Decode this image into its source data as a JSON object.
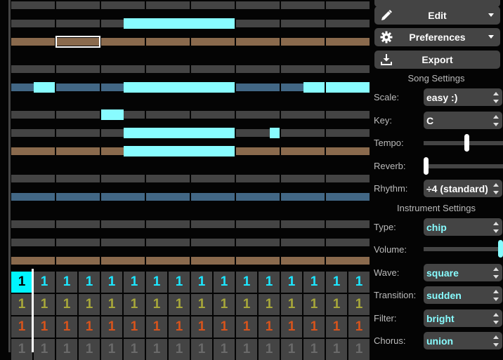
{
  "colors": {
    "note": "#88fcff",
    "gray_row": "#444444",
    "brown_row": "#8a6a4d",
    "blue_row": "#426785",
    "pattern_bg": "#444444",
    "pattern_active": "#00f5ff",
    "channel_colors": [
      "#1de6ff",
      "#a8a83a",
      "#d8541c",
      "#6a6a6a"
    ],
    "instrument_value_color": "#88fcff",
    "song_value_color": "#ffffff"
  },
  "note_editor": {
    "bars": 8,
    "rows": [
      {
        "color": "gray",
        "notes": []
      },
      {
        "color": "gray",
        "notes": [
          [
            2.5,
            5
          ]
        ]
      },
      {
        "color": "brown",
        "notes": [],
        "selected_bar": 1
      },
      {
        "color": "gray",
        "notes": []
      },
      {
        "color": "blue",
        "notes": [
          [
            0.5,
            1
          ],
          [
            2.5,
            5
          ],
          [
            6.5,
            7
          ],
          [
            7,
            8
          ]
        ]
      },
      {
        "color": "gray",
        "notes": [
          [
            2,
            2.5
          ]
        ]
      },
      {
        "color": "gray",
        "notes": [
          [
            2.5,
            5
          ],
          [
            5.75,
            6
          ]
        ]
      },
      {
        "color": "brown",
        "notes": [
          [
            2.5,
            5
          ]
        ]
      },
      {
        "color": "gray",
        "notes": []
      },
      {
        "color": "blue",
        "notes": []
      },
      {
        "color": "gray",
        "notes": []
      },
      {
        "color": "gray",
        "notes": []
      },
      {
        "color": "brown",
        "notes": []
      }
    ]
  },
  "pattern_grid": {
    "columns": 16,
    "channels": [
      {
        "values": [
          "1",
          "1",
          "1",
          "1",
          "1",
          "1",
          "1",
          "1",
          "1",
          "1",
          "1",
          "1",
          "1",
          "1",
          "1",
          "1"
        ]
      },
      {
        "values": [
          "1",
          "1",
          "1",
          "1",
          "1",
          "1",
          "1",
          "1",
          "1",
          "1",
          "1",
          "1",
          "1",
          "1",
          "1",
          "1"
        ]
      },
      {
        "values": [
          "1",
          "1",
          "1",
          "1",
          "1",
          "1",
          "1",
          "1",
          "1",
          "1",
          "1",
          "1",
          "1",
          "1",
          "1",
          "1"
        ]
      },
      {
        "values": [
          "1",
          "1",
          "1",
          "1",
          "1",
          "1",
          "1",
          "1",
          "1",
          "1",
          "1",
          "1",
          "1",
          "1",
          "1",
          "1"
        ]
      }
    ],
    "active_cell": {
      "channel": 0,
      "column": 0
    }
  },
  "menu": {
    "edit": {
      "label": "Edit",
      "icon": "pencil-icon"
    },
    "preferences": {
      "label": "Preferences",
      "icon": "gear-icon"
    },
    "export": {
      "label": "Export",
      "icon": "download-icon"
    }
  },
  "song_settings": {
    "title": "Song Settings",
    "scale": {
      "label": "Scale:",
      "value": "easy :)"
    },
    "key": {
      "label": "Key:",
      "value": "C"
    },
    "tempo": {
      "label": "Tempo:",
      "value": 0.55
    },
    "reverb": {
      "label": "Reverb:",
      "value": 0.0
    },
    "rhythm": {
      "label": "Rhythm:",
      "value": "÷4 (standard)"
    }
  },
  "instrument_settings": {
    "title": "Instrument Settings",
    "type": {
      "label": "Type:",
      "value": "chip"
    },
    "volume": {
      "label": "Volume:",
      "value": 1.0
    },
    "wave": {
      "label": "Wave:",
      "value": "square"
    },
    "transition": {
      "label": "Transition:",
      "value": "sudden"
    },
    "filter": {
      "label": "Filter:",
      "value": "bright"
    },
    "chorus": {
      "label": "Chorus:",
      "value": "union"
    }
  }
}
